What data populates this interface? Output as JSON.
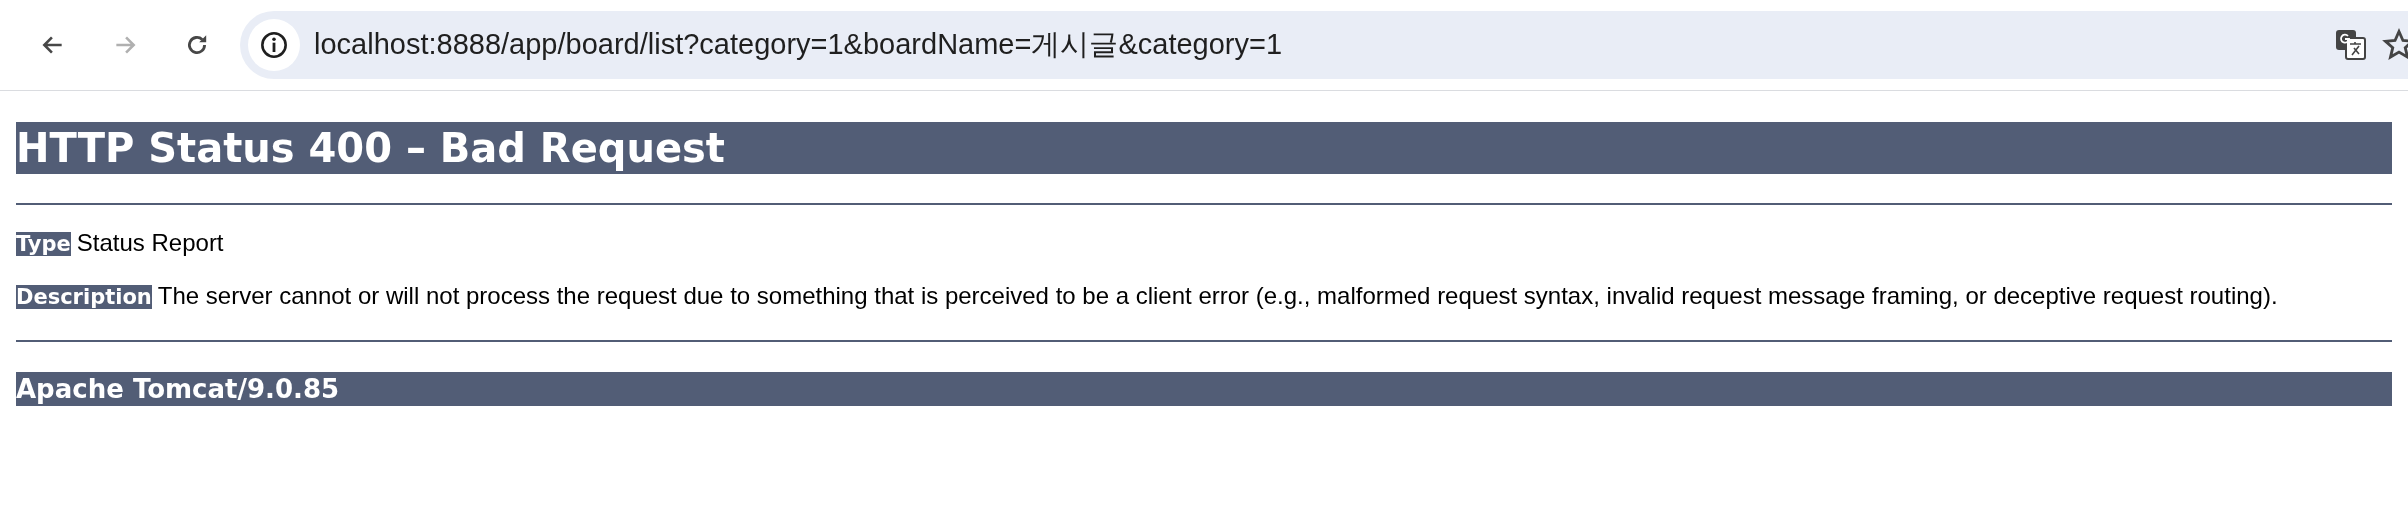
{
  "toolbar": {
    "nav_buttons": [
      {
        "kind": "back",
        "disabled": false
      },
      {
        "kind": "forward",
        "disabled": true
      },
      {
        "kind": "reload",
        "disabled": false
      }
    ],
    "url": "localhost:8888/app/board/list?category=1&boardName=게시글&category=1"
  },
  "page": {
    "title": "HTTP Status 400 – Bad Request",
    "fields": [
      {
        "label": "Type",
        "value": "Status Report"
      },
      {
        "label": "Description",
        "value": "The server cannot or will not process the request due to something that is perceived to be a client error (e.g., malformed request syntax, invalid request message framing, or deceptive request routing)."
      }
    ],
    "footer": "Apache Tomcat/9.0.85"
  }
}
